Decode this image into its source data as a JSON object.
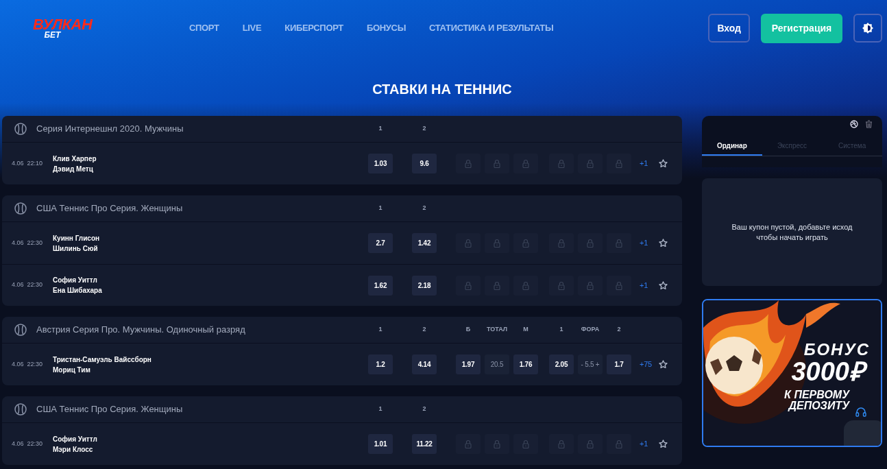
{
  "logo": {
    "main": "ВУЛКАН",
    "sub": "БЕТ"
  },
  "nav": [
    {
      "label": "СПОРТ"
    },
    {
      "label": "LIVE"
    },
    {
      "label": "КИБЕРСПОРТ"
    },
    {
      "label": "БОНУСЫ"
    },
    {
      "label": "СТАТИСТИКА И РЕЗУЛЬТАТЫ"
    }
  ],
  "auth": {
    "login": "Вход",
    "register": "Регистрация"
  },
  "page_title": "СТАВКИ НА ТЕННИС",
  "groups": [
    {
      "title": "Серия Интернешнл 2020. Мужчины",
      "outcome_headers": [
        "1",
        "2"
      ],
      "matches": [
        {
          "date": "4.06",
          "time": "22:10",
          "players": [
            "Клив Харпер",
            "Дэвид Метц"
          ],
          "win": [
            "1.03",
            "9.6"
          ],
          "markets": [
            {
              "kind": "locked"
            },
            {
              "kind": "locked"
            },
            {
              "kind": "locked"
            },
            {
              "kind": "locked"
            },
            {
              "kind": "locked"
            },
            {
              "kind": "locked"
            }
          ],
          "more": "+1",
          "favorite": false
        }
      ]
    },
    {
      "title": "США Теннис Про Серия. Женщины",
      "outcome_headers": [
        "1",
        "2"
      ],
      "matches": [
        {
          "date": "4.06",
          "time": "22:30",
          "players": [
            "Куинн Глисон",
            "Шилинь Сюй"
          ],
          "win": [
            "2.7",
            "1.42"
          ],
          "markets": [
            {
              "kind": "locked"
            },
            {
              "kind": "locked"
            },
            {
              "kind": "locked"
            },
            {
              "kind": "locked"
            },
            {
              "kind": "locked"
            },
            {
              "kind": "locked"
            }
          ],
          "more": "+1",
          "favorite": false
        },
        {
          "date": "4.06",
          "time": "22:30",
          "players": [
            "София Уиттл",
            "Ена Шибахара"
          ],
          "win": [
            "1.62",
            "2.18"
          ],
          "markets": [
            {
              "kind": "locked"
            },
            {
              "kind": "locked"
            },
            {
              "kind": "locked"
            },
            {
              "kind": "locked"
            },
            {
              "kind": "locked"
            },
            {
              "kind": "locked"
            }
          ],
          "more": "+1",
          "favorite": false
        }
      ]
    },
    {
      "title": "Австрия Серия Про. Мужчины. Одиночный разряд",
      "outcome_headers": [
        "1",
        "2"
      ],
      "total_headers": [
        "Б",
        "ТОТАЛ",
        "М"
      ],
      "handicap_headers": [
        "1",
        "ФОРА",
        "2"
      ],
      "matches": [
        {
          "date": "4.06",
          "time": "22:30",
          "players": [
            "Тристан-Самуэль Вайссборн",
            "Мориц Тим"
          ],
          "win": [
            "1.2",
            "4.14"
          ],
          "markets": [
            {
              "kind": "odd",
              "value": "1.97"
            },
            {
              "kind": "param",
              "value": "20.5"
            },
            {
              "kind": "odd",
              "value": "1.76"
            },
            {
              "kind": "odd",
              "value": "2.05"
            },
            {
              "kind": "param",
              "value": "- 5.5 +"
            },
            {
              "kind": "odd",
              "value": "1.7"
            }
          ],
          "more": "+75",
          "favorite": false
        }
      ]
    },
    {
      "title": "США Теннис Про Серия. Женщины",
      "outcome_headers": [
        "1",
        "2"
      ],
      "matches": [
        {
          "date": "4.06",
          "time": "22:30",
          "players": [
            "София Уиттл",
            "Мэри Клосс"
          ],
          "win": [
            "1.01",
            "11.22"
          ],
          "markets": [
            {
              "kind": "locked"
            },
            {
              "kind": "locked"
            },
            {
              "kind": "locked"
            },
            {
              "kind": "locked"
            },
            {
              "kind": "locked"
            },
            {
              "kind": "locked"
            }
          ],
          "more": "+1",
          "favorite": false
        }
      ]
    }
  ],
  "coupon": {
    "tabs": [
      {
        "label": "Ординар",
        "selected": true
      },
      {
        "label": "Экспресс",
        "selected": false
      },
      {
        "label": "Система",
        "selected": false
      }
    ],
    "empty_message": "Ваш купон пустой, добавьте исход чтобы начать играть"
  },
  "banner": {
    "title": "БОНУС",
    "amount": "3000₽",
    "subtitle": "К ПЕРВОМУ ДЕПОЗИТУ"
  }
}
